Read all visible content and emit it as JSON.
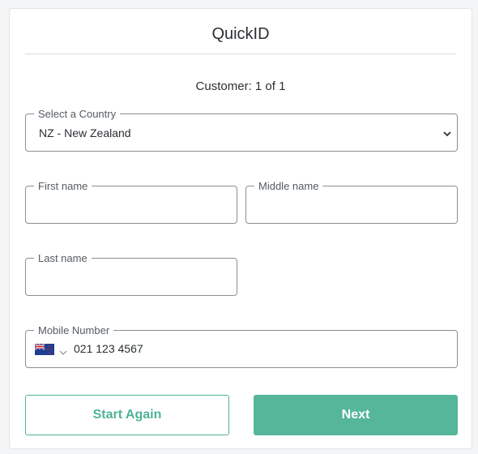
{
  "app": {
    "title": "QuickID"
  },
  "customer": {
    "label": "Customer: 1 of 1"
  },
  "form": {
    "country": {
      "label": "Select a Country",
      "value": "NZ - New Zealand"
    },
    "first_name": {
      "label": "First name",
      "value": ""
    },
    "middle_name": {
      "label": "Middle name",
      "value": ""
    },
    "last_name": {
      "label": "Last name",
      "value": ""
    },
    "mobile": {
      "label": "Mobile Number",
      "value": "021 123 4567",
      "flag_icon": "nz-flag-icon"
    }
  },
  "actions": {
    "start_again": "Start Again",
    "next": "Next"
  },
  "colors": {
    "accent": "#55b69a",
    "border": "#8a8f94"
  }
}
